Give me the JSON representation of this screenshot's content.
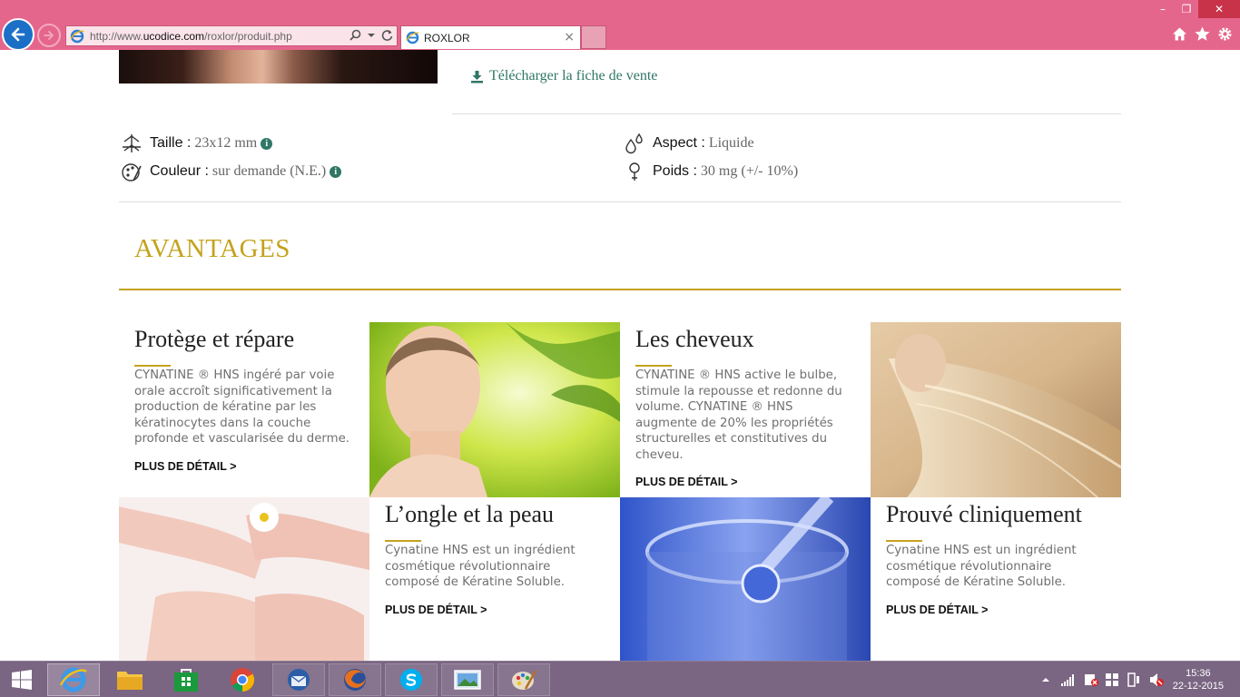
{
  "browser": {
    "url_prefix": "http://www.",
    "url_domain": "ucodice.com",
    "url_path": "/roxlor/produit.php",
    "tab_title": "ROXLOR",
    "tab_close": "×",
    "win_min": "–",
    "win_max": "❐",
    "win_close": "✕"
  },
  "download": {
    "label": "Télécharger la fiche de vente"
  },
  "specs": {
    "taille": {
      "label": "Taille :",
      "value": "23x12 mm"
    },
    "couleur": {
      "label": "Couleur :",
      "value": "sur demande (N.E.)"
    },
    "aspect": {
      "label": "Aspect :",
      "value": "Liquide"
    },
    "poids": {
      "label": "Poids :",
      "value": "30 mg (+/- 10%)"
    },
    "info_glyph": "i"
  },
  "avantages": {
    "title": "AVANTAGES",
    "cards": [
      {
        "title": "Protège et répare",
        "text": "CYNATINE ® HNS ingéré par voie orale accroît significativement la production de kératine par les kératinocytes dans la couche profonde et vascularisée du derme.",
        "more": "PLUS DE DÉTAIL >"
      },
      {
        "title": "Les cheveux",
        "text": "CYNATINE ® HNS active le bulbe, stimule la repousse et redonne du volume. CYNATINE ® HNS augmente de 20% les propriétés structurelles et constitutives du cheveu.",
        "more": "PLUS DE DÉTAIL >"
      },
      {
        "title": "L’ongle et la peau",
        "text": "Cynatine HNS est un ingrédient cosmétique révolutionnaire composé de Kératine Soluble.",
        "more": "PLUS DE DÉTAIL >"
      },
      {
        "title": "Prouvé cliniquement",
        "text": "Cynatine HNS est un ingrédient cosmétique révolutionnaire composé de Kératine Soluble.",
        "more": "PLUS DE DÉTAIL >"
      }
    ]
  },
  "taskbar": {
    "time": "15:36",
    "date": "22-12-2015",
    "apps": [
      "internet-explorer",
      "file-explorer",
      "store",
      "chrome",
      "thunderbird",
      "firefox",
      "skype",
      "photos",
      "paint"
    ]
  },
  "colors": {
    "chrome": "#e5668c",
    "gold": "#c4a21e",
    "teal": "#2f7766",
    "taskbar": "#7a6582"
  }
}
